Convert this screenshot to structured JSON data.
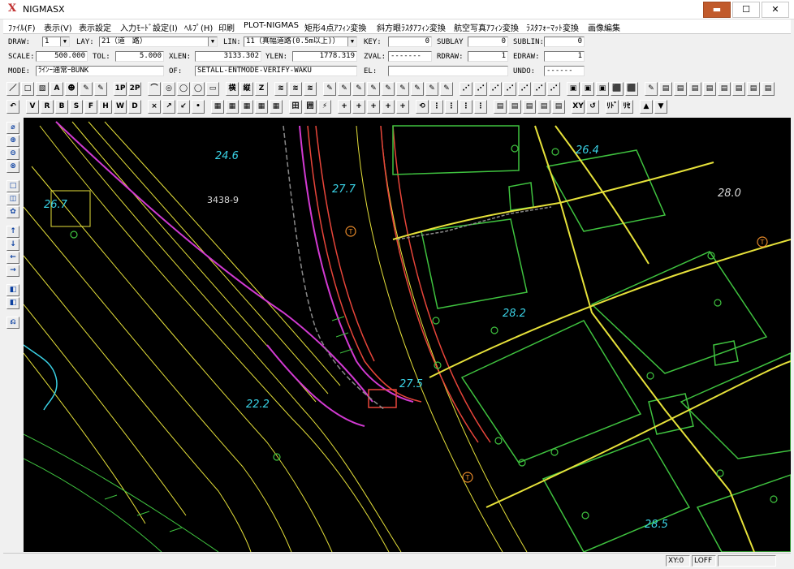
{
  "window": {
    "title": "NIGMASX",
    "app_icon": "X",
    "min": "▬",
    "max": "☐",
    "close": "✕"
  },
  "menu": [
    "ﾌｧｲﾙ(F)",
    "表示(V)",
    "表示設定",
    "入力ﾓｰﾄﾞ設定(I)",
    "ﾍﾙﾌﾟ(H)",
    "印刷",
    "PLOT-NIGMAS",
    "矩形4点ｱﾌｨﾝ変換",
    "斜方眼ﾗｽﾀｱﾌｨﾝ変換",
    "航空写真ｱﾌｨﾝ変換",
    "ﾗｽﾀﾌｫｰﾏｯﾄ変換",
    "画像編集"
  ],
  "params": {
    "draw_label": "DRAW:",
    "draw_value": "1",
    "lay_label": "LAY:",
    "lay_value": "21（道　路）",
    "lin_label": "LIN:",
    "lin_value": "11（真幅道路(0.5m以上)）",
    "key_label": "KEY:",
    "key_value": "0",
    "sublay_label": "SUBLAY",
    "sublay_value": "0",
    "sublin_label": "SUBLIN:",
    "sublin_value": "0",
    "scale_label": "SCALE:",
    "scale_value": "500.000",
    "tol_label": "TOL:",
    "tol_value": "5.000",
    "xlen_label": "XLEN:",
    "xlen_value": "3133.302",
    "ylen_label": "YLEN:",
    "ylen_value": "1778.319",
    "zval_label": "ZVAL:",
    "zval_value": "-------",
    "rdraw_label": "RDRAW:",
    "rdraw_value": "1",
    "edraw_label": "EDRAW:",
    "edraw_value": "1",
    "mode_label": "MODE:",
    "mode_value": "ﾗｲﾝｰ通常ｰBUNK",
    "of_label": "OF:",
    "of_value": "SETALL-ENTMODE-VERIFY-WAKU",
    "el_label": "EL:",
    "el_value": "",
    "undo_label": "UNDO:",
    "undo_value": "------"
  },
  "toolbar1": [
    "／",
    "□",
    "▧",
    "A",
    "☻",
    "✎",
    "✎",
    "1P",
    "2P",
    "⌒",
    "◎",
    "◯",
    "◯",
    "▭",
    "横",
    "縦",
    "Z",
    "≋",
    "≋",
    "≋",
    "✎",
    "✎",
    "✎",
    "✎",
    "✎",
    "✎",
    "✎",
    "✎",
    "✎",
    "⋰",
    "⋰",
    "⋰",
    "⋰",
    "⋰",
    "⋰",
    "⋰",
    "▣",
    "▣",
    "▣",
    "⬛",
    "⬛",
    "✎",
    "▤",
    "▤",
    "▤",
    "▤",
    "▤",
    "▤",
    "▤",
    "▤"
  ],
  "toolbar2": [
    "↶",
    "V",
    "R",
    "B",
    "S",
    "F",
    "H",
    "W",
    "D",
    "×",
    "↗",
    "↙",
    "•",
    "▦",
    "▦",
    "▦",
    "▦",
    "▦",
    "田",
    "囲",
    "⚡",
    "+",
    "+",
    "+",
    "+",
    "+",
    "⟲",
    "⋮",
    "⋮",
    "⋮",
    "⋮",
    "▤",
    "▤",
    "▤",
    "▤",
    "▤",
    "XY",
    "↺",
    "ﾘﾄﾞ",
    "ﾘｾ",
    "▲",
    "▼"
  ],
  "lefttools": [
    "⌀",
    "⊕",
    "⊖",
    "⊗",
    "□",
    "◫",
    "✿",
    "↑",
    "↓",
    "←",
    "→",
    "◧",
    "◧",
    "⎌"
  ],
  "map": {
    "labels": [
      "24.6",
      "3438-9",
      "27.7",
      "26.4",
      "28.0",
      "28.2",
      "27.5",
      "22.2",
      "28.5",
      "26.7"
    ],
    "symbol": "T"
  },
  "status": {
    "xy": "XY:0",
    "loff": "LOFF",
    "extra": ""
  },
  "colors": {
    "accent": "#c15a2b",
    "canvas": "#000000",
    "yellow": "#e6e13a",
    "green": "#3fc23f",
    "magenta": "#d23ad2",
    "red": "#e8453a",
    "cyan": "#3ad2e6"
  }
}
